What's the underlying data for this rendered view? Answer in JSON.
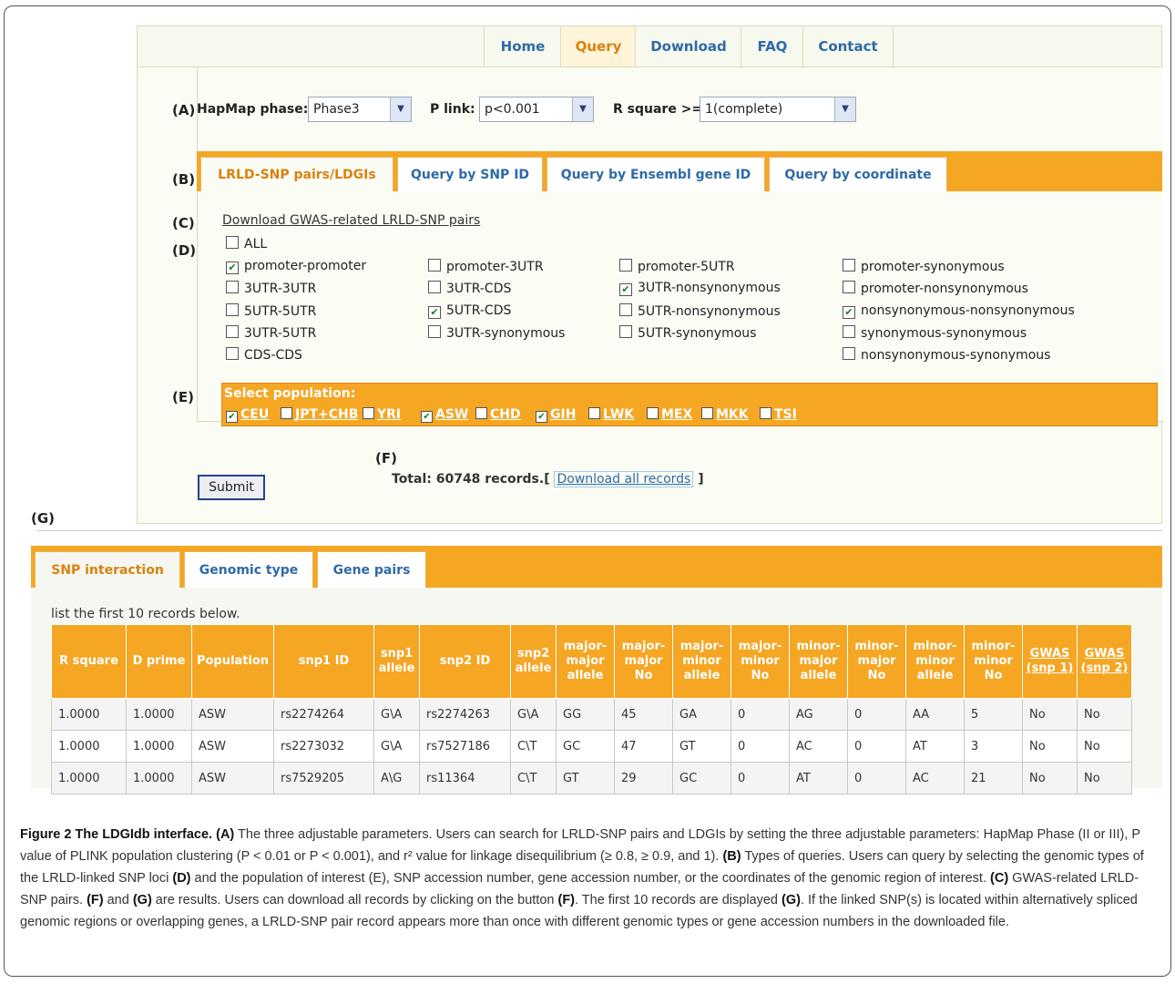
{
  "nav": {
    "items": [
      "Home",
      "Query",
      "Download",
      "FAQ",
      "Contact"
    ],
    "active": "Query"
  },
  "markers": {
    "A": "(A)",
    "B": "(B)",
    "C": "(C)",
    "D": "(D)",
    "E": "(E)",
    "F": "(F)",
    "G": "(G)"
  },
  "params": {
    "hapmap_label": "HapMap phase:",
    "hapmap_value": "Phase3",
    "plink_label": "P link:",
    "plink_value": "p<0.001",
    "rsq_label": "R square >=",
    "rsq_value": "1(complete)"
  },
  "query_tabs": [
    "LRLD-SNP pairs/LDGIs",
    "Query by SNP ID",
    "Query by Ensembl gene ID",
    "Query by coordinate"
  ],
  "gwas_link": "Download GWAS-related LRLD-SNP pairs",
  "all_label": "ALL",
  "genomic_types": [
    {
      "label": "promoter-promoter",
      "checked": true
    },
    {
      "label": "3UTR-3UTR",
      "checked": false
    },
    {
      "label": "5UTR-5UTR",
      "checked": false
    },
    {
      "label": "3UTR-5UTR",
      "checked": false
    },
    {
      "label": "CDS-CDS",
      "checked": false
    },
    {
      "label": "promoter-3UTR",
      "checked": false
    },
    {
      "label": "3UTR-CDS",
      "checked": false
    },
    {
      "label": "5UTR-CDS",
      "checked": true
    },
    {
      "label": "3UTR-synonymous",
      "checked": false
    },
    {
      "label": "promoter-5UTR",
      "checked": false
    },
    {
      "label": "3UTR-nonsynonymous",
      "checked": true
    },
    {
      "label": "5UTR-nonsynonymous",
      "checked": false
    },
    {
      "label": "5UTR-synonymous",
      "checked": false
    },
    {
      "label": "promoter-synonymous",
      "checked": false
    },
    {
      "label": "promoter-nonsynonymous",
      "checked": false
    },
    {
      "label": "nonsynonymous-nonsynonymous",
      "checked": true
    },
    {
      "label": "synonymous-synonymous",
      "checked": false
    },
    {
      "label": "nonsynonymous-synonymous",
      "checked": false
    }
  ],
  "population": {
    "title": "Select population:",
    "items": [
      {
        "label": "CEU",
        "checked": true
      },
      {
        "label": "JPT+CHB",
        "checked": false
      },
      {
        "label": "YRI",
        "checked": false
      },
      {
        "label": "ASW",
        "checked": true
      },
      {
        "label": "CHD",
        "checked": false
      },
      {
        "label": "GIH",
        "checked": true
      },
      {
        "label": "LWK",
        "checked": false
      },
      {
        "label": "MEX",
        "checked": false
      },
      {
        "label": "MKK",
        "checked": false
      },
      {
        "label": "TSI",
        "checked": false
      }
    ]
  },
  "submit_label": "Submit",
  "total": {
    "prefix": "Total: 60748 records.[",
    "link": "Download all records",
    "suffix": "]"
  },
  "result_tabs": [
    "SNP interaction",
    "Genomic type",
    "Gene pairs"
  ],
  "list_note": "list the first 10 records below.",
  "table": {
    "headers": [
      "R square",
      "D prime",
      "Population",
      "snp1 ID",
      "snp1 allele",
      "snp2 ID",
      "snp2 allele",
      "major-major allele",
      "major-major No",
      "major-minor allele",
      "major-minor No",
      "minor-major allele",
      "minor-major No",
      "minor-minor allele",
      "minor-minor No",
      "GWAS (snp 1)",
      "GWAS (snp 2)"
    ],
    "rows": [
      [
        "1.0000",
        "1.0000",
        "ASW",
        "rs2274264",
        "G\\A",
        "rs2274263",
        "G\\A",
        "GG",
        "45",
        "GA",
        "0",
        "AG",
        "0",
        "AA",
        "5",
        "No",
        "No"
      ],
      [
        "1.0000",
        "1.0000",
        "ASW",
        "rs2273032",
        "G\\A",
        "rs7527186",
        "C\\T",
        "GC",
        "47",
        "GT",
        "0",
        "AC",
        "0",
        "AT",
        "3",
        "No",
        "No"
      ],
      [
        "1.0000",
        "1.0000",
        "ASW",
        "rs7529205",
        "A\\G",
        "rs11364",
        "C\\T",
        "GT",
        "29",
        "GC",
        "0",
        "AT",
        "0",
        "AC",
        "21",
        "No",
        "No"
      ]
    ]
  },
  "caption": {
    "fig": "Figure 2 The LDGIdb interface.",
    "A": "(A)",
    "text_a": " The three adjustable parameters. Users can search for LRLD-SNP pairs and LDGIs by setting the three adjustable parameters: HapMap Phase (II or III), P value of PLINK population clustering (P < 0.01 or P < 0.001), and r² value for linkage disequilibrium (≥ 0.8, ≥ 0.9, and 1). ",
    "B": "(B)",
    "text_b": " Types of queries. Users can query by selecting the genomic types of the LRLD-linked SNP loci ",
    "D": "(D)",
    "text_d": " and the population of interest (E), SNP accession number, gene accession number, or the coordinates of the genomic region of interest. ",
    "C": "(C)",
    "text_c": " GWAS-related LRLD-SNP pairs. ",
    "F": "(F)",
    "text_f": " and ",
    "G": "(G)",
    "text_g": " are results. Users can download all records by clicking on the button ",
    "F2": "(F)",
    "text_f2": ". The first 10 records are displayed ",
    "G2": "(G)",
    "text_g2": ". If the linked SNP(s) is located within alternatively spliced genomic regions or overlapping genes, a LRLD-SNP pair record appears more than once with different genomic types or gene accession numbers in the downloaded file."
  }
}
